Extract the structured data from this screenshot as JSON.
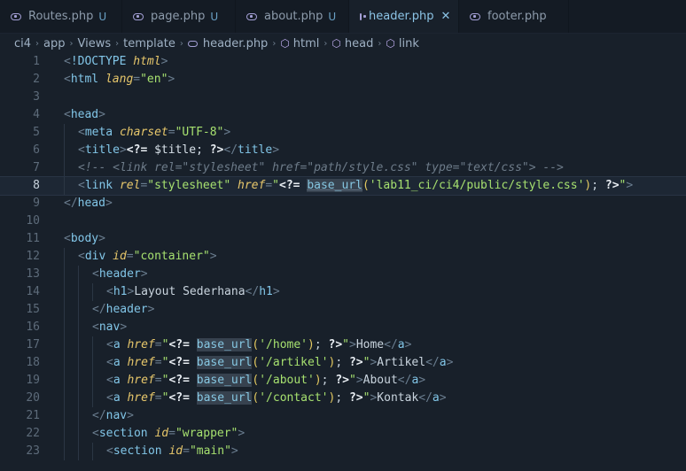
{
  "tabs": [
    {
      "label": "Routes.php",
      "status": "U",
      "active": false,
      "icon": "php-file-icon"
    },
    {
      "label": "page.php",
      "status": "U",
      "active": false,
      "icon": "php-file-icon"
    },
    {
      "label": "about.php",
      "status": "U",
      "active": false,
      "icon": "php-file-icon"
    },
    {
      "label": "header.php",
      "status": "",
      "active": true,
      "icon": "php-file-icon",
      "close": "✕"
    },
    {
      "label": "footer.php",
      "status": "",
      "active": false,
      "icon": "php-file-icon"
    }
  ],
  "breadcrumb": [
    "ci4",
    "app",
    "Views",
    "template",
    "header.php",
    "html",
    "head",
    "link"
  ],
  "current_line": 8,
  "lines": [
    {
      "n": "1",
      "indent": 0,
      "guides": 0,
      "tokens": [
        [
          "pun",
          "<"
        ],
        [
          "tag",
          "!DOCTYPE "
        ],
        [
          "attr",
          "html"
        ],
        [
          "pun",
          ">"
        ]
      ]
    },
    {
      "n": "2",
      "indent": 0,
      "guides": 0,
      "tokens": [
        [
          "pun",
          "<"
        ],
        [
          "tag",
          "html "
        ],
        [
          "attr",
          "lang"
        ],
        [
          "pun",
          "="
        ],
        [
          "str",
          "\"en\""
        ],
        [
          "pun",
          ">"
        ]
      ]
    },
    {
      "n": "3",
      "indent": 0,
      "guides": 0,
      "tokens": []
    },
    {
      "n": "4",
      "indent": 0,
      "guides": 0,
      "tokens": [
        [
          "pun",
          "<"
        ],
        [
          "tag",
          "head"
        ],
        [
          "pun",
          ">"
        ]
      ]
    },
    {
      "n": "5",
      "indent": 1,
      "guides": 1,
      "tokens": [
        [
          "pun",
          "<"
        ],
        [
          "tag",
          "meta "
        ],
        [
          "attr",
          "charset"
        ],
        [
          "pun",
          "="
        ],
        [
          "str",
          "\"UTF-8\""
        ],
        [
          "pun",
          ">"
        ]
      ]
    },
    {
      "n": "6",
      "indent": 1,
      "guides": 1,
      "tokens": [
        [
          "pun",
          "<"
        ],
        [
          "tag",
          "title"
        ],
        [
          "pun",
          ">"
        ],
        [
          "php",
          "<?= "
        ],
        [
          "var",
          "$title; "
        ],
        [
          "php",
          "?>"
        ],
        [
          "pun",
          "</"
        ],
        [
          "tag",
          "title"
        ],
        [
          "pun",
          ">"
        ]
      ]
    },
    {
      "n": "7",
      "indent": 1,
      "guides": 1,
      "tokens": [
        [
          "com",
          "<!-- <link rel=\"stylesheet\" href=\"path/style.css\" type=\"text/css\"> -->"
        ]
      ]
    },
    {
      "n": "8",
      "indent": 1,
      "guides": 1,
      "tokens": [
        [
          "pun",
          "<"
        ],
        [
          "tag",
          "link "
        ],
        [
          "attr",
          "rel"
        ],
        [
          "pun",
          "="
        ],
        [
          "str",
          "\"stylesheet\" "
        ],
        [
          "attr",
          "href"
        ],
        [
          "pun",
          "="
        ],
        [
          "str",
          "\""
        ],
        [
          "php",
          "<?= "
        ],
        [
          "fn",
          "base_url"
        ],
        [
          "paren",
          "("
        ],
        [
          "str",
          "'lab11_ci/ci4/public/style.css'"
        ],
        [
          "paren",
          ")"
        ],
        [
          "txt",
          "; "
        ],
        [
          "php",
          "?>"
        ],
        [
          "str",
          "\""
        ],
        [
          "pun",
          ">"
        ]
      ]
    },
    {
      "n": "9",
      "indent": 0,
      "guides": 0,
      "tokens": [
        [
          "pun",
          "</"
        ],
        [
          "tag",
          "head"
        ],
        [
          "pun",
          ">"
        ]
      ]
    },
    {
      "n": "10",
      "indent": 0,
      "guides": 0,
      "tokens": []
    },
    {
      "n": "11",
      "indent": 0,
      "guides": 0,
      "tokens": [
        [
          "pun",
          "<"
        ],
        [
          "tag",
          "body"
        ],
        [
          "pun",
          ">"
        ]
      ]
    },
    {
      "n": "12",
      "indent": 1,
      "guides": 1,
      "tokens": [
        [
          "pun",
          "<"
        ],
        [
          "tag",
          "div "
        ],
        [
          "attr",
          "id"
        ],
        [
          "pun",
          "="
        ],
        [
          "str",
          "\"container\""
        ],
        [
          "pun",
          ">"
        ]
      ]
    },
    {
      "n": "13",
      "indent": 2,
      "guides": 2,
      "tokens": [
        [
          "pun",
          "<"
        ],
        [
          "tag",
          "header"
        ],
        [
          "pun",
          ">"
        ]
      ]
    },
    {
      "n": "14",
      "indent": 3,
      "guides": 3,
      "tokens": [
        [
          "pun",
          "<"
        ],
        [
          "tag",
          "h1"
        ],
        [
          "pun",
          ">"
        ],
        [
          "txt",
          "Layout Sederhana"
        ],
        [
          "pun",
          "</"
        ],
        [
          "tag",
          "h1"
        ],
        [
          "pun",
          ">"
        ]
      ]
    },
    {
      "n": "15",
      "indent": 2,
      "guides": 2,
      "tokens": [
        [
          "pun",
          "</"
        ],
        [
          "tag",
          "header"
        ],
        [
          "pun",
          ">"
        ]
      ]
    },
    {
      "n": "16",
      "indent": 2,
      "guides": 2,
      "tokens": [
        [
          "pun",
          "<"
        ],
        [
          "tag",
          "nav"
        ],
        [
          "pun",
          ">"
        ]
      ]
    },
    {
      "n": "17",
      "indent": 3,
      "guides": 3,
      "tokens": [
        [
          "pun",
          "<"
        ],
        [
          "tag",
          "a "
        ],
        [
          "attr",
          "href"
        ],
        [
          "pun",
          "="
        ],
        [
          "str",
          "\""
        ],
        [
          "php",
          "<?= "
        ],
        [
          "fn2",
          "base_url"
        ],
        [
          "paren",
          "("
        ],
        [
          "str",
          "'/home'"
        ],
        [
          "paren",
          ")"
        ],
        [
          "txt",
          "; "
        ],
        [
          "php",
          "?>"
        ],
        [
          "str",
          "\""
        ],
        [
          "pun",
          ">"
        ],
        [
          "txt",
          "Home"
        ],
        [
          "pun",
          "</"
        ],
        [
          "tag",
          "a"
        ],
        [
          "pun",
          ">"
        ]
      ]
    },
    {
      "n": "18",
      "indent": 3,
      "guides": 3,
      "tokens": [
        [
          "pun",
          "<"
        ],
        [
          "tag",
          "a "
        ],
        [
          "attr",
          "href"
        ],
        [
          "pun",
          "="
        ],
        [
          "str",
          "\""
        ],
        [
          "php",
          "<?= "
        ],
        [
          "fn2",
          "base_url"
        ],
        [
          "paren",
          "("
        ],
        [
          "str",
          "'/artikel'"
        ],
        [
          "paren",
          ")"
        ],
        [
          "txt",
          "; "
        ],
        [
          "php",
          "?>"
        ],
        [
          "str",
          "\""
        ],
        [
          "pun",
          ">"
        ],
        [
          "txt",
          "Artikel"
        ],
        [
          "pun",
          "</"
        ],
        [
          "tag",
          "a"
        ],
        [
          "pun",
          ">"
        ]
      ]
    },
    {
      "n": "19",
      "indent": 3,
      "guides": 3,
      "tokens": [
        [
          "pun",
          "<"
        ],
        [
          "tag",
          "a "
        ],
        [
          "attr",
          "href"
        ],
        [
          "pun",
          "="
        ],
        [
          "str",
          "\""
        ],
        [
          "php",
          "<?= "
        ],
        [
          "fn2",
          "base_url"
        ],
        [
          "paren",
          "("
        ],
        [
          "str",
          "'/about'"
        ],
        [
          "paren",
          ")"
        ],
        [
          "txt",
          "; "
        ],
        [
          "php",
          "?>"
        ],
        [
          "str",
          "\""
        ],
        [
          "pun",
          ">"
        ],
        [
          "txt",
          "About"
        ],
        [
          "pun",
          "</"
        ],
        [
          "tag",
          "a"
        ],
        [
          "pun",
          ">"
        ]
      ]
    },
    {
      "n": "20",
      "indent": 3,
      "guides": 3,
      "tokens": [
        [
          "pun",
          "<"
        ],
        [
          "tag",
          "a "
        ],
        [
          "attr",
          "href"
        ],
        [
          "pun",
          "="
        ],
        [
          "str",
          "\""
        ],
        [
          "php",
          "<?= "
        ],
        [
          "fn2",
          "base_url"
        ],
        [
          "paren",
          "("
        ],
        [
          "str",
          "'/contact'"
        ],
        [
          "paren",
          ")"
        ],
        [
          "txt",
          "; "
        ],
        [
          "php",
          "?>"
        ],
        [
          "str",
          "\""
        ],
        [
          "pun",
          ">"
        ],
        [
          "txt",
          "Kontak"
        ],
        [
          "pun",
          "</"
        ],
        [
          "tag",
          "a"
        ],
        [
          "pun",
          ">"
        ]
      ]
    },
    {
      "n": "21",
      "indent": 2,
      "guides": 2,
      "tokens": [
        [
          "pun",
          "</"
        ],
        [
          "tag",
          "nav"
        ],
        [
          "pun",
          ">"
        ]
      ]
    },
    {
      "n": "22",
      "indent": 2,
      "guides": 2,
      "tokens": [
        [
          "pun",
          "<"
        ],
        [
          "tag",
          "section "
        ],
        [
          "attr",
          "id"
        ],
        [
          "pun",
          "="
        ],
        [
          "str",
          "\"wrapper\""
        ],
        [
          "pun",
          ">"
        ]
      ]
    },
    {
      "n": "23",
      "indent": 3,
      "guides": 3,
      "tokens": [
        [
          "pun",
          "<"
        ],
        [
          "tag",
          "section "
        ],
        [
          "attr",
          "id"
        ],
        [
          "pun",
          "="
        ],
        [
          "str",
          "\"main\""
        ],
        [
          "pun",
          ">"
        ]
      ]
    }
  ]
}
